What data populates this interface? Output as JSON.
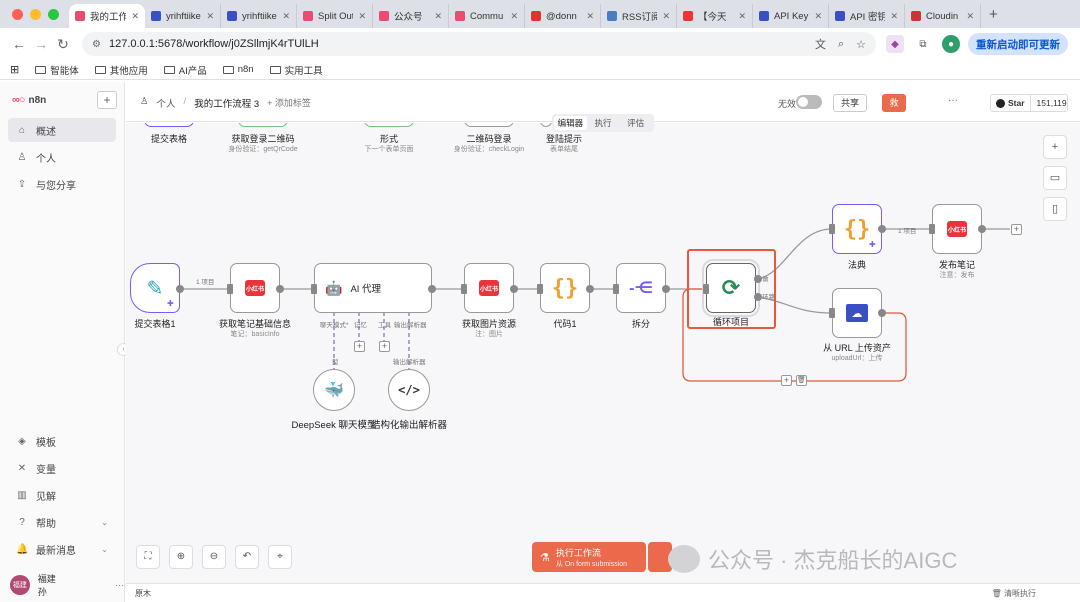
{
  "browser": {
    "tabs": [
      {
        "title": "我的工作",
        "color": "#ea4b71",
        "active": true
      },
      {
        "title": "yrihftiike",
        "color": "#3b4fc4"
      },
      {
        "title": "yrihftiike",
        "color": "#3b4fc4"
      },
      {
        "title": "Split Out",
        "color": "#ea4b71"
      },
      {
        "title": "公众号",
        "color": "#ea4b71"
      },
      {
        "title": "Commu",
        "color": "#ea4b71"
      },
      {
        "title": "@donn",
        "color": "#d33"
      },
      {
        "title": "RSS订阅",
        "color": "#4a7cc4"
      },
      {
        "title": "【今天",
        "color": "#e33"
      },
      {
        "title": "API Key",
        "color": "#3b4fc4"
      },
      {
        "title": "API 密钥",
        "color": "#3b4fc4"
      },
      {
        "title": "Cloudin",
        "color": "#c33"
      }
    ],
    "new_tab": "+",
    "url": "127.0.0.1:5678/workflow/j0ZSllmjK4rTUlLH",
    "relaunch": "重新启动即可更新",
    "bookmarks": [
      "智能体",
      "其他应用",
      "AI产品",
      "n8n",
      "实用工具"
    ]
  },
  "sidebar": {
    "brand": "n8n",
    "add": "+",
    "nav": [
      {
        "label": "概述",
        "icon": "⌂",
        "active": true
      },
      {
        "label": "个人",
        "icon": "♙"
      },
      {
        "label": "与您分享",
        "icon": "⇪"
      }
    ],
    "bottom": [
      {
        "label": "模板",
        "icon": "◈"
      },
      {
        "label": "变量",
        "icon": "✕"
      },
      {
        "label": "见解",
        "icon": "▥"
      },
      {
        "label": "帮助",
        "icon": "?",
        "caret": true
      },
      {
        "label": "最新消息",
        "icon": "🔔",
        "caret": true
      }
    ],
    "user": {
      "avatar": "福建",
      "name": "福建 孙",
      "more": "···"
    }
  },
  "topbar": {
    "crumb_owner": "个人",
    "crumb_sep": "/",
    "workflow_name": "我的工作流程 3",
    "add_tag": "+ 添加标签",
    "active_label": "无效",
    "share": "共享",
    "save": "救",
    "more": "···",
    "github_star": "Star",
    "github_count": "151,119"
  },
  "mode_tabs": [
    "编辑器",
    "执行",
    "评估"
  ],
  "nodes": {
    "top": [
      {
        "label": "提交表格",
        "sub": ""
      },
      {
        "label": "获取登录二维码",
        "sub": "身份验证：getQrCode"
      },
      {
        "label": "形式",
        "sub": "下一个表单页面"
      },
      {
        "label": "二维码登录",
        "sub": "身份验证：checkLogin"
      },
      {
        "label": "登陆提示",
        "sub": "表单结尾"
      }
    ],
    "submit": {
      "label": "提交表格1"
    },
    "get_notes": {
      "label": "获取笔记基础信息",
      "sub": "笔记：basicInfo",
      "icon": "小红书"
    },
    "ai_agent": {
      "label": "AI 代理"
    },
    "get_images": {
      "label": "获取图片资源",
      "sub": "注：图片",
      "icon": "小红书"
    },
    "code1": {
      "label": "代码1"
    },
    "split": {
      "label": "拆分"
    },
    "loop": {
      "label": "循环项目"
    },
    "code_top": {
      "label": "法典"
    },
    "publish": {
      "label": "发布笔记",
      "sub": "注意：发布",
      "icon": "小红书"
    },
    "upload": {
      "label": "从 URL 上传资产",
      "sub": "uploadUrl：上传"
    },
    "deepseek": {
      "label": "DeepSeek 聊天模型"
    },
    "parser": {
      "label": "结构化输出解析器"
    }
  },
  "edge_labels": {
    "one_item_a": "1 项目",
    "one_item_b": "1 项目",
    "chat_model": "聊天模式*",
    "memory": "记忆",
    "tool": "工具",
    "out_parser": "输出解析器",
    "model_small": "型",
    "parser_small": "输出解析器",
    "done": "做",
    "loop": "环路"
  },
  "canvas_tools": {
    "right": [
      "+",
      "▭",
      "▯"
    ],
    "bottom": [
      "⛶",
      "⊕",
      "⊖",
      "↶",
      "⌖"
    ]
  },
  "execute": {
    "title": "执行工作流",
    "subtitle": "从 On form submission"
  },
  "watermark": "公众号 · 杰克船长的AIGC",
  "status": {
    "left": "原木",
    "right": "清晰执行"
  }
}
